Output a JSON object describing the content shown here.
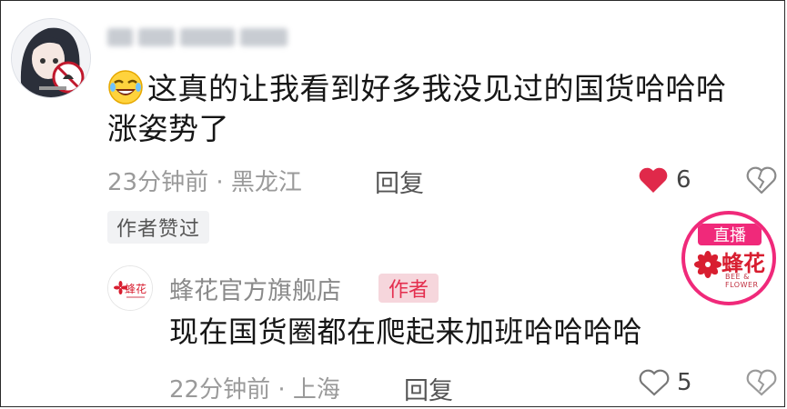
{
  "comment": {
    "username": "",
    "text_line1": "这真的让我看到好多我没见过的国货哈哈哈",
    "text_line2": "涨姿势了",
    "time": "23分钟前",
    "separator": "·",
    "location": "黑龙江",
    "reply_label": "回复",
    "like_count": "6",
    "liked": true,
    "author_liked_tag": "作者赞过"
  },
  "reply": {
    "name": "蜂花官方旗舰店",
    "author_tag": "作者",
    "text": "现在国货圈都在爬起来加班哈哈哈哈",
    "time": "22分钟前",
    "separator": "·",
    "location": "上海",
    "reply_label": "回复",
    "like_count": "5",
    "liked": false,
    "logo_text": "蜂花"
  },
  "live_badge": {
    "label": "直播",
    "brand": "蜂花",
    "sub": "BEE & FLOWER"
  },
  "colors": {
    "like_red": "#e0294a",
    "author_tag_bg": "#f6d6dc",
    "author_tag_text": "#e42e4e",
    "live_pink": "#f0297a",
    "meta_gray": "#9a9a9a"
  },
  "icons": [
    "laughing-emoji-icon",
    "heart-filled-icon",
    "heart-outline-icon",
    "broken-heart-icon",
    "bee-flower-logo-icon"
  ]
}
